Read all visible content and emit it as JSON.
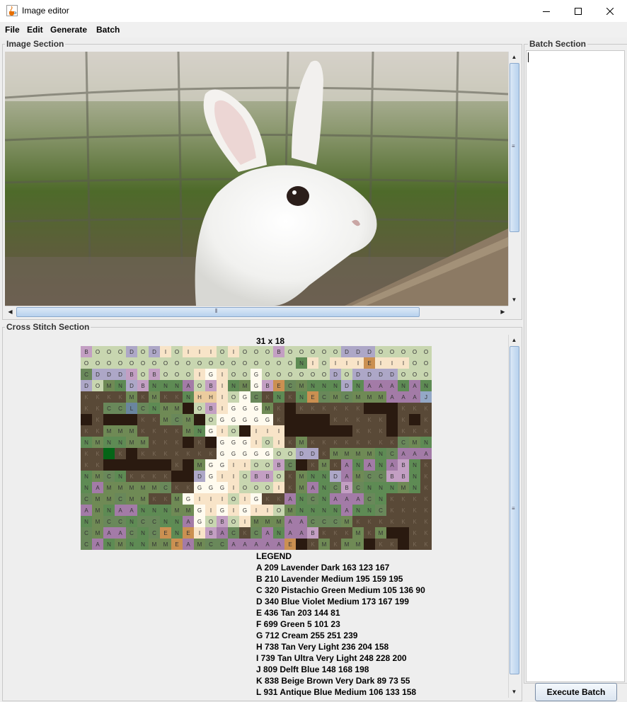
{
  "window": {
    "title": "Image editor",
    "icon": "java-cup-icon",
    "controls": [
      "minimize-icon",
      "maximize-icon",
      "close-icon"
    ]
  },
  "menu": {
    "file": "File",
    "edit": "Edit",
    "generate": "Generate",
    "batch": "Batch"
  },
  "image_section": {
    "title": "Image Section",
    "image": "photo of a white rabbit behind a wire fence"
  },
  "cross_stitch_section": {
    "title": "Cross Stitch Section",
    "dimensions": "31 x 18",
    "grid_rows": [
      "BOOODODIOIIIOIOOOBOOOOODDDOOOOO",
      "OOOOOOOOOOOOOOOOOOONIOIIIEIIIOO",
      "CDDDBOBOOOIGIOOGOOOOOODODDDDOOO",
      "DOMNDBNNNAOBINMGBECMNNNDNAAANAN",
      "KKKKMKMKKNHHIOGCKNKNECMCMMMAAAJ",
      "KKCCLCNMMPOBIGGGMKPKKKKKKPPPKKK",
      "PKPPPKKMCMPOGGGGGKPPPPKKKKKPKPK",
      "KKMMMKKKKMNGIOPIIIPPPPPPKKKPKKK",
      "NMNNMMKKKPKPGGGIOIKMKKKKKKKKCMN",
      "KKFKPKKKKKKKGGGGGOODDKMMMMNCAAAN",
      "KKPPPPPPKPMGGIIOOBCPKMKANANABN",
      "NMCNKKKKPPDGIIOBBOKMNNDAMCCBBN",
      "NAMMMMMCKKGGGIOOOIKMANCBCNNNMN",
      "CMMCMMKKMGIIIOIGKKANCNAAACNKKK",
      "AMNAANNNMMGIGIGIIOMNNNNANNCKKKK",
      "NMCCNCCNNAGOBOIMMMAACCCMKKKKK",
      "CMAACNCENEIBACKCANAABKKKMKMPP",
      "CANMNNMMEAMCCAAAAAEPKMKMMPKKP"
    ],
    "legend_title": "LEGEND",
    "legend": [
      "A 209 Lavender Dark 163 123 167",
      "B 210 Lavender Medium 195 159 195",
      "C 320 Pistachio Green Medium 105 136 90",
      "D 340 Blue Violet Medium 173 167 199",
      "E 436 Tan 203 144 81",
      "F 699 Green 5 101 23",
      "G 712 Cream 255 251 239",
      "H 738 Tan Very Light 236 204 158",
      "I 739 Tan Ultra Very Light 248 228 200",
      "J 809 Delft Blue 148 168 198",
      "K 838 Beige Brown Very Dark 89 73 55",
      "L 931 Antique Blue Medium 106 133 158"
    ],
    "colors": {
      "A": "#a37ba7",
      "B": "#c39fc3",
      "C": "#69885a",
      "D": "#ada7c7",
      "E": "#cb9051",
      "F": "#056517",
      "G": "#fffbef",
      "H": "#eccc9e",
      "I": "#f8e4c8",
      "J": "#94a8c6",
      "K": "#594937",
      "L": "#6a859e",
      "M": "#6f8a55",
      "N": "#5e8b54",
      "O": "#c8d6b0",
      "P": "#2a1a10"
    }
  },
  "batch_section": {
    "title": "Batch Section",
    "execute_label": "Execute Batch"
  }
}
